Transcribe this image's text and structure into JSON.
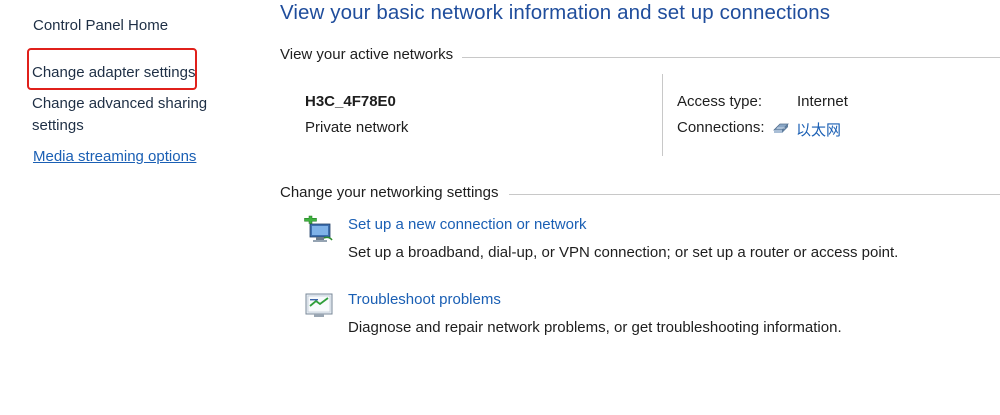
{
  "sidebar": {
    "home": "Control Panel Home",
    "adapter": "Change adapter settings",
    "sharing_line1": "Change advanced sharing",
    "sharing_line2": "settings",
    "media": "Media streaming options"
  },
  "main": {
    "title": "View your basic network information and set up connections",
    "active_networks_heading": "View your active networks",
    "network": {
      "name": "H3C_4F78E0",
      "type": "Private network",
      "access_type_label": "Access type:",
      "access_type_value": "Internet",
      "connections_label": "Connections:",
      "connections_value": "以太网"
    },
    "settings_heading": "Change your networking settings",
    "tasks": [
      {
        "title": "Set up a new connection or network",
        "desc": "Set up a broadband, dial-up, or VPN connection; or set up a router or access point.",
        "icon": "new-connection-icon"
      },
      {
        "title": "Troubleshoot problems",
        "desc": "Diagnose and repair network problems, or get troubleshooting information.",
        "icon": "troubleshoot-icon"
      }
    ]
  },
  "colors": {
    "link": "#1a5fb4",
    "title": "#1f4d9c",
    "highlight": "#e0201b"
  }
}
